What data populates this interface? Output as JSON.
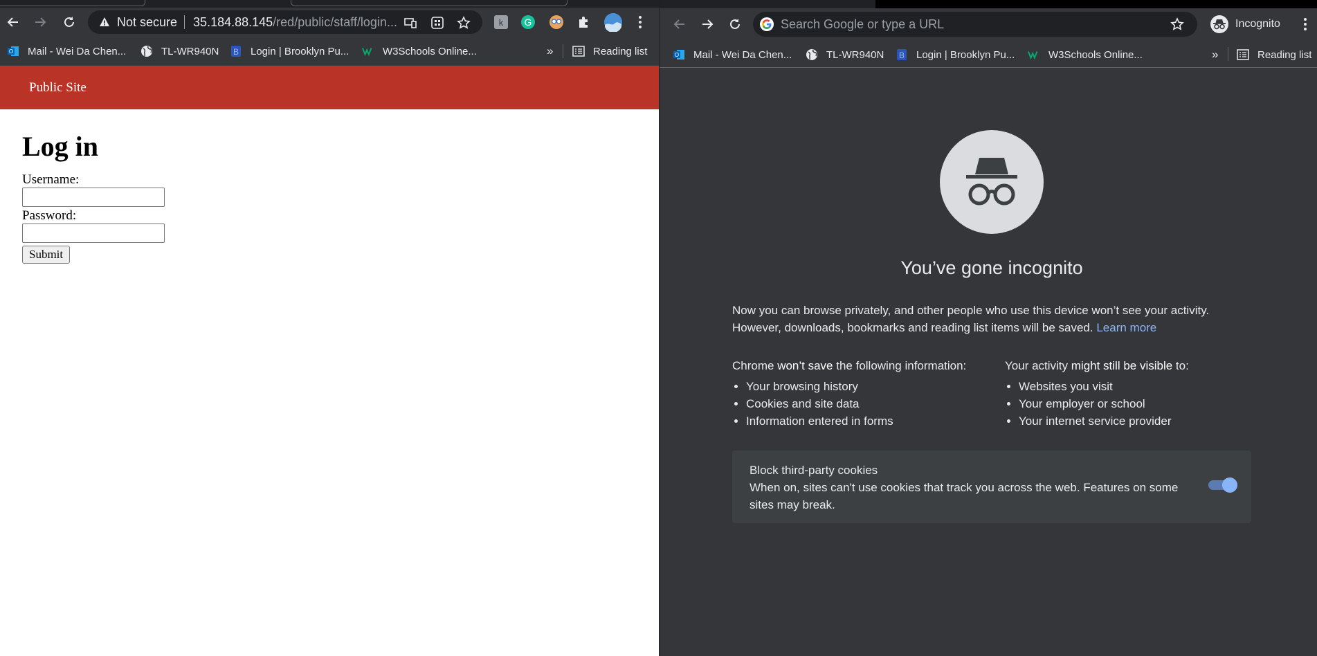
{
  "left_window": {
    "omnibox": {
      "security_label": "Not secure",
      "url_host": "35.184.88.145",
      "url_path": "/red/public/staff/login..."
    },
    "bookmarks": [
      {
        "label": "Mail - Wei Da Chen...",
        "icon": "outlook-icon"
      },
      {
        "label": "TL-WR940N",
        "icon": "globe-icon"
      },
      {
        "label": "Login | Brooklyn Pu...",
        "icon": "b-logo-icon"
      },
      {
        "label": "W3Schools Online...",
        "icon": "w3schools-icon"
      }
    ],
    "bookmarks_overflow": "»",
    "reading_list": "Reading list",
    "page": {
      "site_nav_link": "Public Site",
      "heading": "Log in",
      "username_label": "Username:",
      "username_value": "",
      "password_label": "Password:",
      "password_value": "",
      "submit_label": "Submit"
    }
  },
  "right_window": {
    "omnibox": {
      "placeholder": "Search Google or type a URL"
    },
    "profile_label": "Incognito",
    "bookmarks": [
      {
        "label": "Mail - Wei Da Chen...",
        "icon": "outlook-icon"
      },
      {
        "label": "TL-WR940N",
        "icon": "globe-icon"
      },
      {
        "label": "Login | Brooklyn Pu...",
        "icon": "b-logo-icon"
      },
      {
        "label": "W3Schools Online...",
        "icon": "w3schools-icon"
      }
    ],
    "bookmarks_overflow": "»",
    "reading_list": "Reading list",
    "page": {
      "heading": "You’ve gone incognito",
      "intro_line1": "Now you can browse privately, and other people who use this device won’t see your activity.",
      "intro_line2": "However, downloads, bookmarks and reading list items will be saved.",
      "learn_more": "Learn more",
      "wont_save": {
        "prefix": "Chrome ",
        "bold": "won’t save",
        "suffix": " the following information:",
        "items": [
          "Your browsing history",
          "Cookies and site data",
          "Information entered in forms"
        ]
      },
      "might_be_visible": {
        "prefix": "Your activity ",
        "bold": "might still be visible",
        "suffix": " to:",
        "items": [
          "Websites you visit",
          "Your employer or school",
          "Your internet service provider"
        ]
      },
      "cookies_card": {
        "title": "Block third-party cookies",
        "description": "When on, sites can't use cookies that track you across the web. Features on some sites may break.",
        "toggle_on": true
      }
    }
  },
  "colors": {
    "site_header": "#b93426",
    "chrome_dark": "#35363a",
    "link_blue": "#8ab4f8"
  }
}
